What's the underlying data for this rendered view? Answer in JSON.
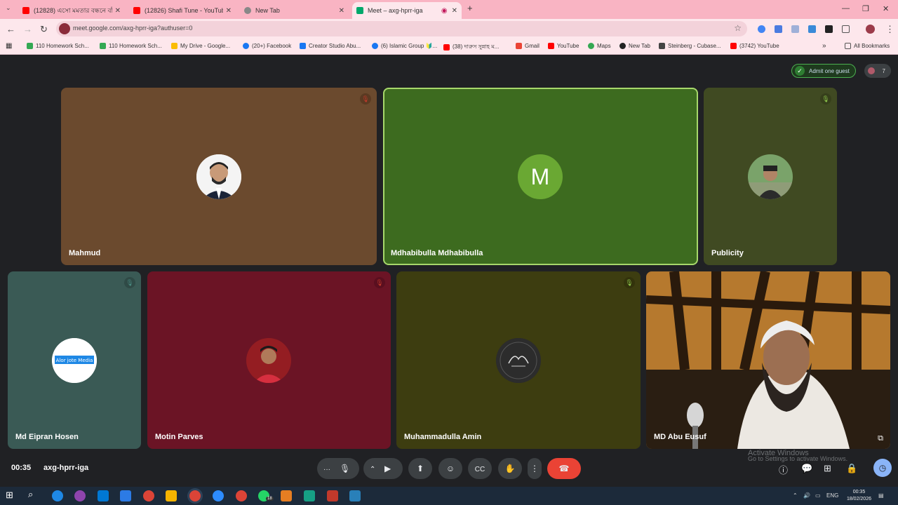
{
  "browser": {
    "tabs": [
      {
        "title": "(12828) এসো মমতার বন্ধনে বাঁ",
        "color": "#ff0000"
      },
      {
        "title": "(12826) Shafi Tune - YouTube",
        "color": "#ff0000"
      },
      {
        "title": "New Tab",
        "color": "#666666"
      },
      {
        "title": "Meet – axg-hprr-iga",
        "color": "#00a86b"
      }
    ],
    "new_tab": "+",
    "url": "meet.google.com/axg-hprr-iga?authuser=0",
    "bookmarks": [
      {
        "label": "110 Homework Sch...",
        "color": "#34a853"
      },
      {
        "label": "110 Homework Sch...",
        "color": "#34a853"
      },
      {
        "label": "My Drive - Google...",
        "color": "#fbbc04"
      },
      {
        "label": "(20+) Facebook",
        "color": "#1877f2"
      },
      {
        "label": "Creator Studio Abu...",
        "color": "#1877f2"
      },
      {
        "label": "(6) Islamic Group 🔰...",
        "color": "#1877f2"
      },
      {
        "label": "(38) দারুস সুন্নাহ ম...",
        "color": "#ff0000"
      },
      {
        "label": "Gmail",
        "color": "#ea4335"
      },
      {
        "label": "YouTube",
        "color": "#ff0000"
      },
      {
        "label": "Maps",
        "color": "#34a853"
      },
      {
        "label": "New Tab",
        "color": "#222222"
      },
      {
        "label": "Steinberg - Cubase...",
        "color": "#444444"
      },
      {
        "label": "(3742) YouTube",
        "color": "#ff0000"
      }
    ],
    "all_bookmarks": "All Bookmarks"
  },
  "meet": {
    "admit_label": "Admit one guest",
    "people_count": "7",
    "participants": [
      {
        "name": "Mahmud",
        "bg": "#6b4a2e",
        "muted": true,
        "mic_color": "#c0392b",
        "avatar": "photo"
      },
      {
        "name": "Mdhabibulla Mdhabibulla",
        "bg": "#3d6b1f",
        "muted": false,
        "avatar": "letter",
        "letter": "M",
        "letter_bg": "#6aa833"
      },
      {
        "name": "Publicity",
        "bg": "#404a22",
        "muted": true,
        "mic_color": "#8bc34a",
        "avatar": "photo"
      },
      {
        "name": "Md Eipran Hosen",
        "bg": "#3a5a55",
        "muted": true,
        "mic_color": "#4a8a80",
        "avatar": "logo",
        "logo_text": "Alor jote Media"
      },
      {
        "name": "Motin Parves",
        "bg": "#6b1425",
        "muted": true,
        "mic_color": "#c0392b",
        "avatar": "photo"
      },
      {
        "name": "Muhammadulla Amin",
        "bg": "#3d3d10",
        "muted": true,
        "mic_color": "#8bc34a",
        "avatar": "photo"
      },
      {
        "name": "MD Abu Eusuf",
        "bg": "#c48a3a",
        "muted": false,
        "avatar": "video"
      }
    ],
    "time": "00:35",
    "meeting_code": "axg-hprr-iga",
    "watermark_title": "Activate Windows",
    "watermark_sub": "Go to Settings to activate Windows."
  },
  "taskbar": {
    "lang": "ENG",
    "time": "00:35",
    "date": "18/02/2026",
    "badge": "18"
  }
}
